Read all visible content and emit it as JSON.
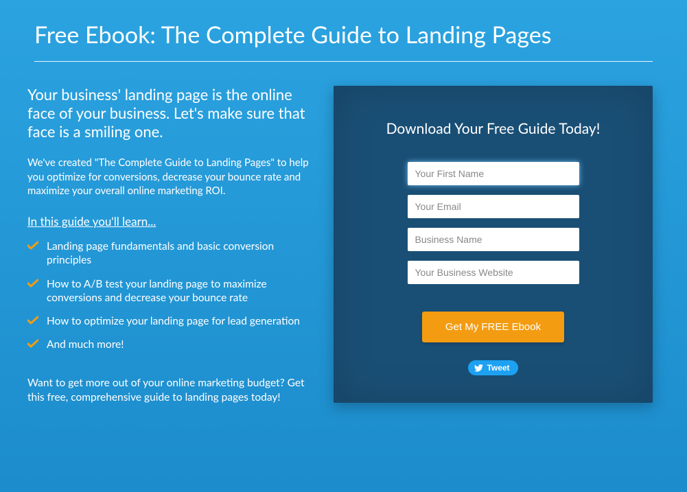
{
  "header": {
    "title": "Free Ebook: The Complete Guide to Landing Pages"
  },
  "content": {
    "lead": "Your business' landing page is the online face of your business. Let's make sure that face is a smiling one.",
    "intro": "We've created \"The Complete Guide to Landing Pages\" to help you optimize for conversions, decrease your bounce rate and maximize your overall online marketing ROI.",
    "learn_heading": "In this guide you'll learn...",
    "bullets": [
      "Landing page fundamentals and basic conversion principles",
      "How to A/B test your landing page to maximize conversions and decrease your bounce rate",
      "How to optimize your landing page for lead generation",
      "And much more!"
    ],
    "closing": "Want to get more out of your online marketing budget? Get this free, comprehensive guide to landing pages today!"
  },
  "form": {
    "heading": "Download Your Free Guide Today!",
    "fields": {
      "first_name": {
        "placeholder": "Your First Name",
        "value": ""
      },
      "email": {
        "placeholder": "Your Email",
        "value": ""
      },
      "business": {
        "placeholder": "Business Name",
        "value": ""
      },
      "website": {
        "placeholder": "Your Business Website",
        "value": ""
      }
    },
    "cta_label": "Get My FREE Ebook",
    "tweet_label": "Tweet"
  },
  "colors": {
    "accent_orange": "#f39c12",
    "panel_blue": "#1a4f75",
    "twitter_blue": "#1da1f2"
  }
}
